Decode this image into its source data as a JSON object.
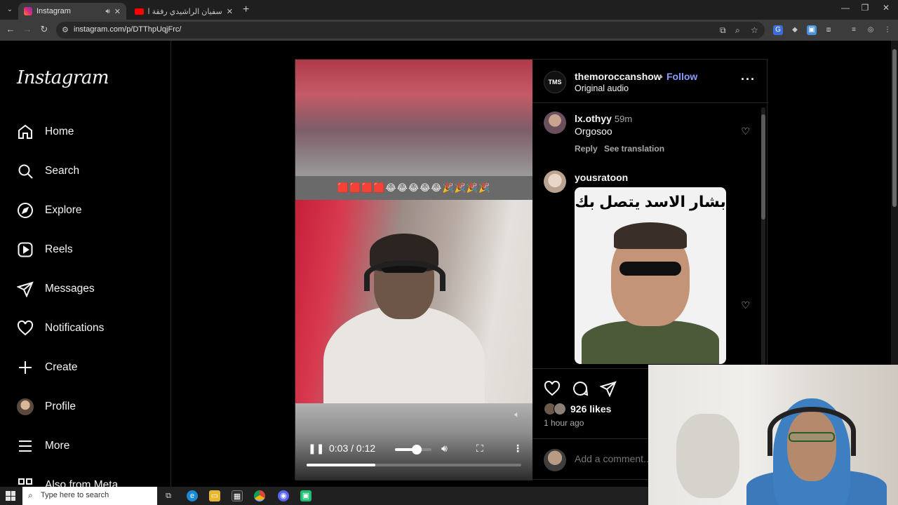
{
  "browser": {
    "tabs": [
      {
        "label": "Instagram",
        "favicon": "instagram-icon"
      },
      {
        "label": "سفيان الراشيدي رفقة الناخ... | ",
        "favicon": "youtube-icon"
      }
    ],
    "url": "instagram.com/p/DTThpUqjFrc/"
  },
  "sidebar": {
    "logo": "Instagram",
    "items": [
      {
        "label": "Home",
        "icon": "home-icon"
      },
      {
        "label": "Search",
        "icon": "search-icon"
      },
      {
        "label": "Explore",
        "icon": "compass-icon"
      },
      {
        "label": "Reels",
        "icon": "reels-icon"
      },
      {
        "label": "Messages",
        "icon": "send-icon"
      },
      {
        "label": "Notifications",
        "icon": "heart-icon"
      },
      {
        "label": "Create",
        "icon": "plus-icon"
      },
      {
        "label": "Profile",
        "icon": "avatar"
      },
      {
        "label": "More",
        "icon": "menu-icon"
      },
      {
        "label": "Also from Meta",
        "icon": "meta-icon"
      }
    ]
  },
  "video": {
    "emoji_band": "🟥🟥🟥🟥😂😂😂😂😂🎉🎉🎉🎉",
    "time": "0:03 / 0:12",
    "progress": 0.32,
    "volume": 0.6
  },
  "post": {
    "username": "themoroccanshow",
    "avatar_text": "TMS",
    "dot": "•",
    "follow": "Follow",
    "audio": "Original audio",
    "comments": [
      {
        "user": "lx.othyy",
        "time": "59m",
        "text": "Orgosoo",
        "reply": "Reply",
        "translate": "See translation"
      },
      {
        "user": "yousratoon",
        "meme_text": "بشار الاسد يتصل بك"
      }
    ],
    "likes": "926 likes",
    "ago": "1 hour ago",
    "add_comment_placeholder": "Add a comment..."
  },
  "taskbar": {
    "search_placeholder": "Type here to search"
  },
  "colors": {
    "follow": "#8c9aff",
    "background": "#000000",
    "border": "#262626"
  }
}
